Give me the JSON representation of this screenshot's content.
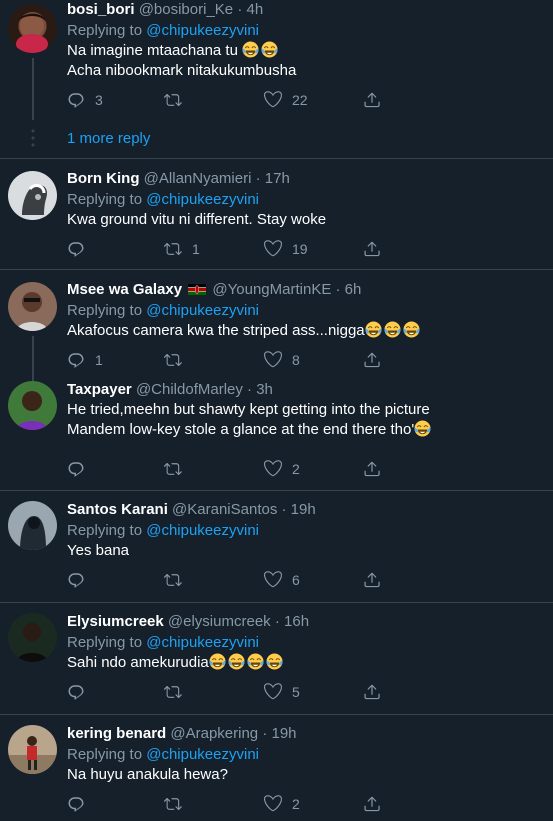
{
  "icons": {
    "reply": "reply-icon",
    "retweet": "retweet-icon",
    "like": "like-icon",
    "share": "share-icon",
    "emoji": "tears-of-joy-emoji",
    "flag": "kenya-flag-icon"
  },
  "colors": {
    "background": "#15202b",
    "link": "#1da1f2",
    "secondary_text": "#8899a6",
    "divider": "#38444d"
  },
  "thread": {
    "more_replies": "1 more reply"
  },
  "tweets": [
    {
      "name": "bosi_bori",
      "handle": "@bosibori_Ke",
      "time": "· 4h",
      "replying_prefix": "Replying to",
      "replying_to": "@chipukeezyvini",
      "lines": [
        "Na imagine mtaachana tu",
        "Acha nibookmark nitakukumbusha"
      ],
      "reply_count": "3",
      "retweet_count": "",
      "like_count": "22"
    },
    {
      "name": "Born King",
      "handle": "@AllanNyamieri",
      "time": "· 17h",
      "replying_prefix": "Replying to",
      "replying_to": "@chipukeezyvini",
      "lines": [
        "Kwa ground vitu ni different. Stay woke"
      ],
      "reply_count": "",
      "retweet_count": "1",
      "like_count": "19"
    },
    {
      "name": "Msee wa Galaxy",
      "handle": "@YoungMartinKE",
      "time": "· 6h",
      "replying_prefix": "Replying to",
      "replying_to": "@chipukeezyvini",
      "lines": [
        "Akafocus  camera kwa the striped ass...nigga"
      ],
      "reply_count": "1",
      "retweet_count": "",
      "like_count": "8"
    },
    {
      "name": "Taxpayer",
      "handle": "@ChildofMarley",
      "time": "· 3h",
      "lines": [
        "He tried,meehn but shawty kept getting into the picture",
        "Mandem low-key stole a glance at the end there tho'"
      ],
      "reply_count": "",
      "retweet_count": "",
      "like_count": "2"
    },
    {
      "name": "Santos Karani",
      "handle": "@KaraniSantos",
      "time": "· 19h",
      "replying_prefix": "Replying to",
      "replying_to": "@chipukeezyvini",
      "lines": [
        "Yes bana"
      ],
      "reply_count": "",
      "retweet_count": "",
      "like_count": "6"
    },
    {
      "name": "Elysiumcreek",
      "handle": "@elysiumcreek",
      "time": "· 16h",
      "replying_prefix": "Replying to",
      "replying_to": "@chipukeezyvini",
      "lines": [
        "Sahi ndo amekurudia"
      ],
      "reply_count": "",
      "retweet_count": "",
      "like_count": "5"
    },
    {
      "name": "kering benard",
      "handle": "@Arapkering",
      "time": "· 19h",
      "replying_prefix": "Replying to",
      "replying_to": "@chipukeezyvini",
      "lines": [
        "Na huyu anakula hewa?"
      ],
      "reply_count": "",
      "retweet_count": "",
      "like_count": "2"
    }
  ]
}
